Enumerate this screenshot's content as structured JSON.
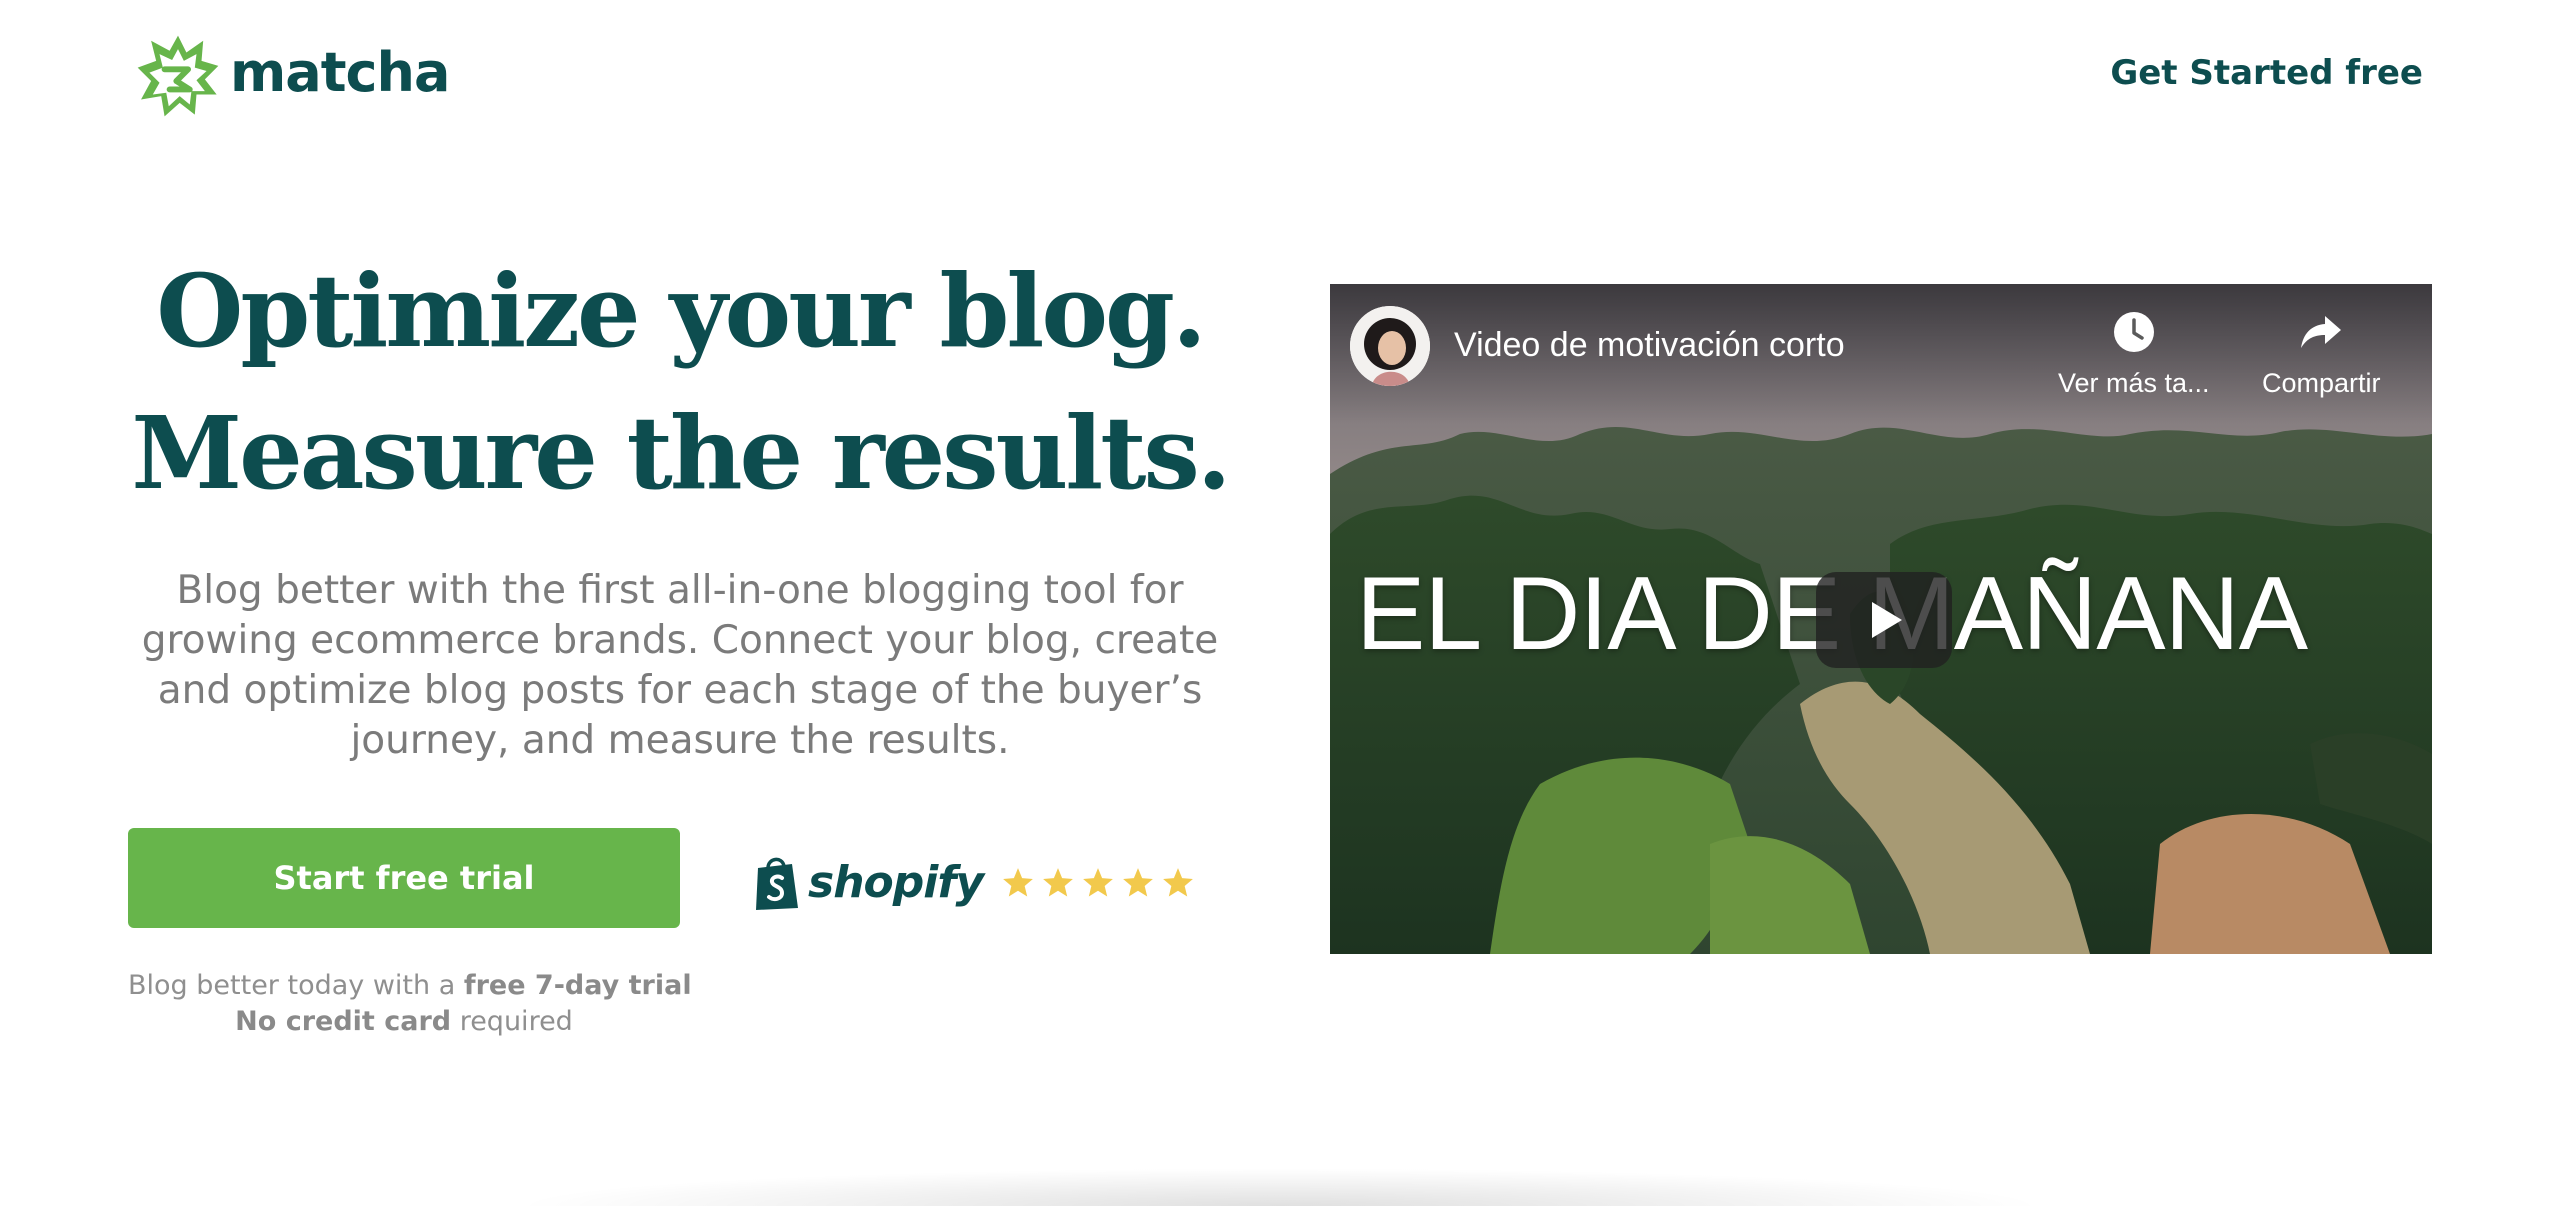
{
  "header": {
    "brand": "matcha",
    "nav_cta": "Get Started free"
  },
  "hero": {
    "title_line1": "Optimize your blog.",
    "title_line2": "Measure the results.",
    "subtitle": "Blog better with the first all-in-one blogging tool for growing ecommerce brands. Connect your blog, create and optimize blog posts for each stage of the buyer’s journey, and measure the results.",
    "cta_label": "Start free trial",
    "trial_note": {
      "prefix": "Blog better today with a ",
      "bold1": "free 7-day trial",
      "bold2": "No credit card",
      "suffix": " required"
    }
  },
  "partner": {
    "name": "shopify",
    "rating_stars": 5,
    "star_color": "#f2c94c"
  },
  "video": {
    "title": "Video de motivación corto",
    "watch_later_label": "Ver más ta...",
    "share_label": "Compartir",
    "headline": "EL DIA DE MAÑANA"
  },
  "colors": {
    "brand_dark": "#0d4d4f",
    "brand_green": "#67b54b",
    "text_muted": "#7b7b7b"
  },
  "icons": [
    "matcha-logo-icon",
    "shopify-bag-icon",
    "star-icon",
    "clock-icon",
    "share-arrow-icon",
    "play-icon"
  ]
}
